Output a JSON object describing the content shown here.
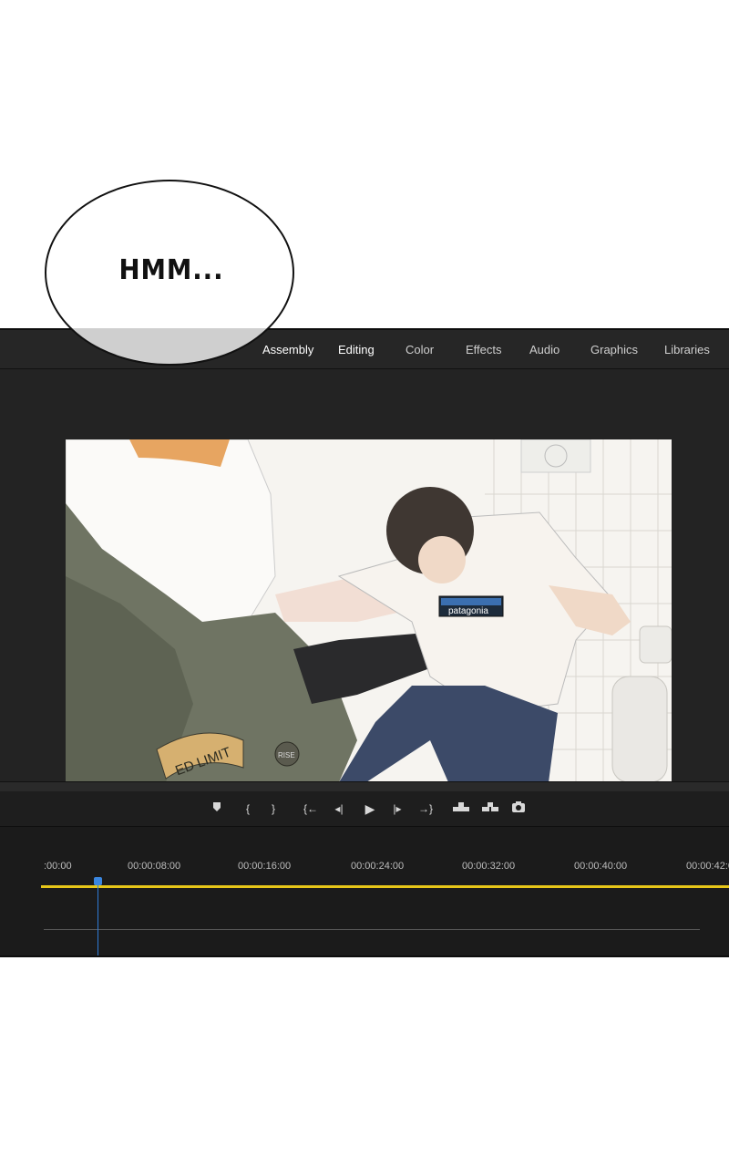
{
  "speech_bubble": {
    "text": "HMM..."
  },
  "workspace_tabs": [
    {
      "label": "Assembly",
      "active": true
    },
    {
      "label": "Editing",
      "active": true
    },
    {
      "label": "Color",
      "active": false
    },
    {
      "label": "Effects",
      "active": false
    },
    {
      "label": "Audio",
      "active": false
    },
    {
      "label": "Graphics",
      "active": false
    },
    {
      "label": "Libraries",
      "active": false
    }
  ],
  "transport_icons": [
    "add-marker-icon",
    "mark-in-icon",
    "mark-out-icon",
    "go-to-in-icon",
    "step-back-icon",
    "play-icon",
    "step-forward-icon",
    "go-to-out-icon",
    "lift-icon",
    "extract-icon",
    "export-frame-icon"
  ],
  "frame": {
    "jacket_patch_text": "ED LIMIT",
    "jacket_badge_text": "RISE",
    "shirt_logo_text": "patagonia"
  },
  "timeline": {
    "timecodes": [
      ":00:00",
      "00:00:08:00",
      "00:00:16:00",
      "00:00:24:00",
      "00:00:32:00",
      "00:00:40:00",
      "00:00:42:0"
    ]
  },
  "colors": {
    "work_area_bar": "#e6c619",
    "playhead": "#3a86e0",
    "panel_bg": "#1f1f1f"
  }
}
